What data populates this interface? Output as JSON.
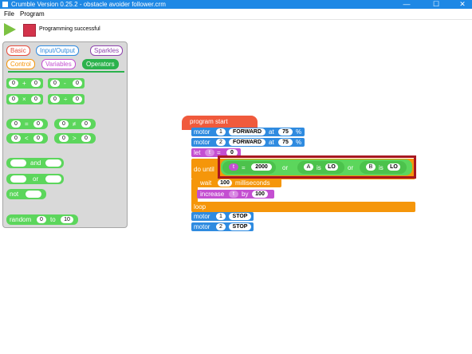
{
  "window": {
    "title": "Crumble Version 0.25.2 - obstacle avoider follower.crm",
    "minimize": "—",
    "maximize": "☐",
    "close": "✕"
  },
  "menu": {
    "file": "File",
    "program": "Program"
  },
  "toolbar": {
    "status": "Programming successful",
    "play_icon": "play-icon",
    "stop_icon": "stop-icon"
  },
  "palette": {
    "tabs": [
      "Basic",
      "Input/Output",
      "Sparkles",
      "Control",
      "Variables",
      "Operators"
    ],
    "active_tab": "Operators",
    "arith": [
      {
        "a": "0",
        "op": "+",
        "b": "0"
      },
      {
        "a": "0",
        "op": "-",
        "b": "0"
      },
      {
        "a": "0",
        "op": "×",
        "b": "0"
      },
      {
        "a": "0",
        "op": "÷",
        "b": "0"
      }
    ],
    "compare": [
      {
        "a": "0",
        "op": "=",
        "b": "0"
      },
      {
        "a": "0",
        "op": "≠",
        "b": "0"
      },
      {
        "a": "0",
        "op": "<",
        "b": "0"
      },
      {
        "a": "0",
        "op": ">",
        "b": "0"
      }
    ],
    "logic": {
      "and": "and",
      "or": "or",
      "not": "not"
    },
    "random": {
      "label": "random",
      "from": "0",
      "to_label": "to",
      "to": "10"
    }
  },
  "script": {
    "start": "program start",
    "motor_label": "motor",
    "motor1": {
      "num": "1",
      "dir": "FORWARD",
      "at": "at",
      "speed": "75",
      "pct": "%"
    },
    "motor2": {
      "num": "2",
      "dir": "FORWARD",
      "at": "at",
      "speed": "75",
      "pct": "%"
    },
    "let": {
      "label": "let",
      "var": "t",
      "eq": "=",
      "val": "0"
    },
    "do_until": "do until",
    "cond": {
      "var": "t",
      "eq": "=",
      "val": "2000",
      "or1": "or",
      "a": "A",
      "is": "is",
      "lo": "LO",
      "or2": "or",
      "b": "B"
    },
    "wait": {
      "label": "wait",
      "val": "100",
      "unit": "milliseconds"
    },
    "increase": {
      "label": "increase",
      "var": "t",
      "by": "by",
      "val": "100"
    },
    "loop": "loop",
    "stop1": {
      "num": "1",
      "state": "STOP"
    },
    "stop2": {
      "num": "2",
      "state": "STOP"
    }
  },
  "colors": {
    "titlebar": "#1e88e5",
    "operator_green": "#5cd65c",
    "motor_blue": "#2f8be0",
    "variable_purple": "#c44fd1",
    "control_orange": "#f5960a",
    "start_red": "#f05a3c",
    "highlight_red": "#a8171f"
  }
}
